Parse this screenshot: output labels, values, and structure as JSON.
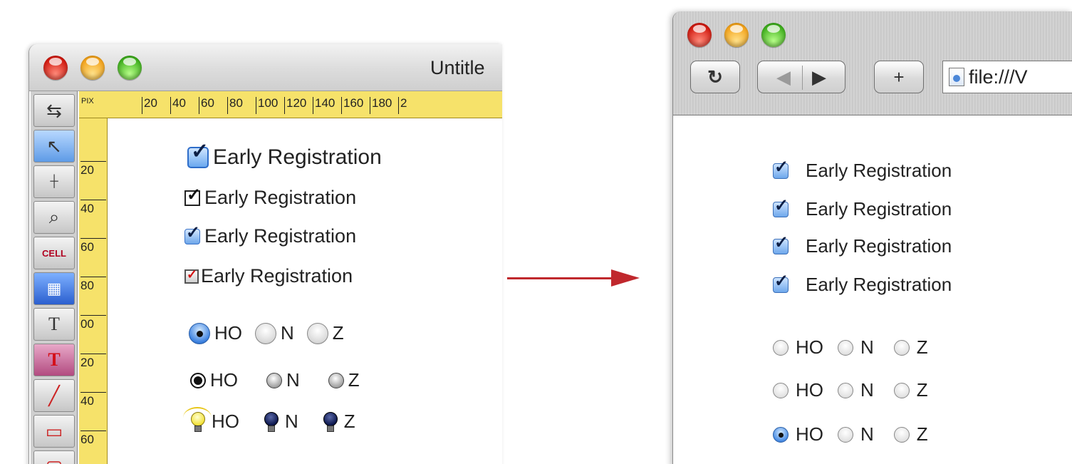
{
  "designer": {
    "window_title": "Untitle",
    "ruler_unit": "PIX",
    "h_ticks": [
      "20",
      "40",
      "60",
      "80",
      "100",
      "120",
      "140",
      "160",
      "180",
      "2"
    ],
    "v_ticks": [
      "20",
      "40",
      "60",
      "80",
      "00",
      "20",
      "40",
      "60"
    ],
    "tools": [
      "arrow-tool",
      "crosshair-tool",
      "magnifier-tool",
      "cell-tool",
      "field-tool",
      "text-tool",
      "red-text-tool",
      "line-tool",
      "rectangle-tool",
      "rounded-rectangle-tool"
    ],
    "cell_tool_label": "CELL",
    "checkbox_label": "Early Registration",
    "checkbox_styles": [
      "aqua-large",
      "plain",
      "aqua-small",
      "red-check"
    ],
    "radio_options": [
      "HO",
      "N",
      "Z"
    ],
    "radio_selected": "HO"
  },
  "browser": {
    "url": "file:///V",
    "checkbox_label": "Early Registration",
    "checkbox_count": 4,
    "radio_options": [
      "HO",
      "N",
      "Z"
    ],
    "radio_rows_selected": [
      "",
      "",
      "HO"
    ]
  },
  "arrow_color": "#c0282d"
}
